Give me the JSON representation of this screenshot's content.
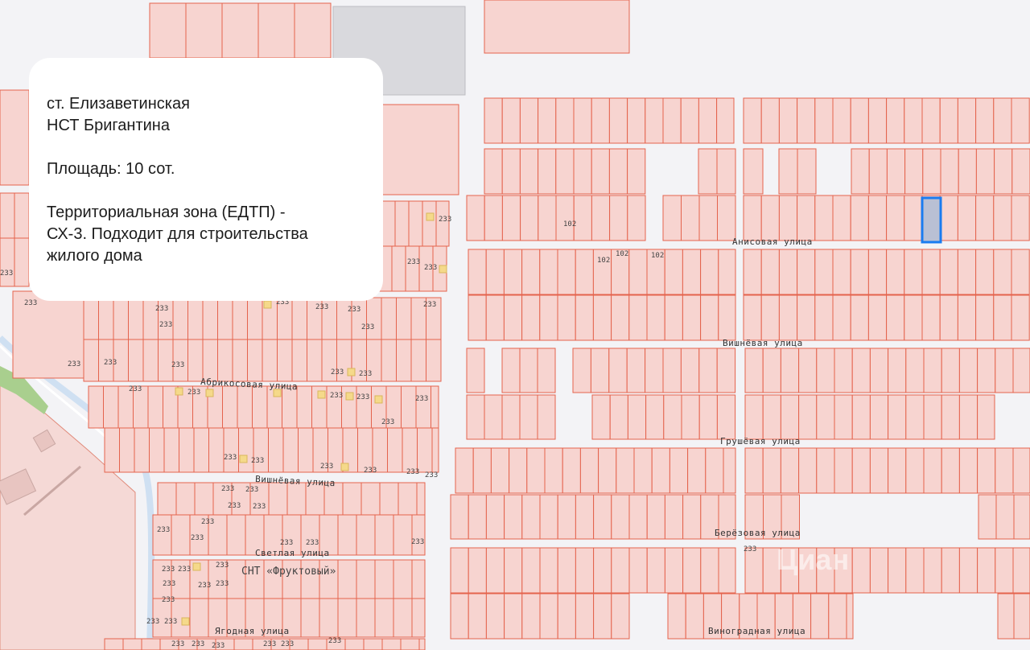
{
  "info_card": {
    "settlement": "ст. Елизаветинская",
    "partnership": "НСТ Бригантина",
    "area": "Площадь: 10 сот.",
    "zone_line1": "Территориальная зона (ЕДТП) -",
    "zone_line2": "СХ-3. Подходит для строительства",
    "zone_line3": "жилого дома"
  },
  "streets": {
    "anisovaya": "Анисовая улица",
    "vishnevaya_east": "Вишнёвая улица",
    "grushevaya": "Грушёвая улица",
    "berezovaya": "Берёзовая улица",
    "vinogradnaya": "Виноградная улица",
    "abrikosovaya": "Абрикосовая улица",
    "vishnevaya_west": "Вишнёвая улица",
    "svetlaya": "Светлая улица",
    "yagodnaya": "Ягодная улица"
  },
  "settlement_label": "СНТ «Фруктовый»",
  "zone_codes": {
    "a": "233",
    "b": "102"
  },
  "watermark": "Циан",
  "colors": {
    "parcel_fill": "#f7d4d0",
    "parcel_stroke": "#e4634d",
    "selected_fill": "#b9c0d4",
    "selected_stroke": "#1a7cf0",
    "road": "#f3f3f6",
    "gray_block": "#d9d9dd",
    "green": "#a9cf8e",
    "water": "#cfe0f2"
  }
}
